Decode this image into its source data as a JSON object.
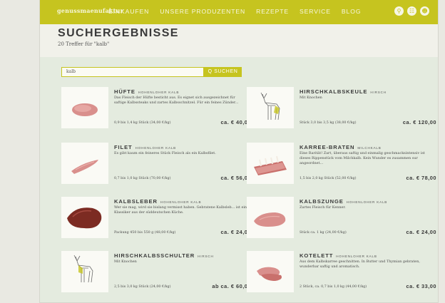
{
  "header": {
    "logo_text": "genussmaenufaktur",
    "nav": [
      "EINKAUFEN",
      "UNSERE PRODUZENTEN",
      "REZEPTE",
      "SERVICE",
      "BLOG"
    ],
    "icons": [
      "search-icon",
      "cart-icon",
      "user-icon"
    ]
  },
  "page": {
    "title": "SUCHERGEBNISSE",
    "subtitle": "20 Treffer für \"kalb\""
  },
  "search": {
    "value": "kalb",
    "button_label": "Q SUCHEN"
  },
  "colors": {
    "accent": "#c6c41f",
    "band": "#e4ebdf",
    "meat": "#d98f8c"
  },
  "products": [
    {
      "name": "HÜFTE",
      "category": "HOHENLOHER KALB",
      "description": "Das Fleisch der Hüfte besticht aus. Es eignet sich ausgezeichnet für saftige Kalbssteaks und zartes Kalbsschnitzel. Für ein feines Zünder...",
      "weight": "0,9 bis 1,4 kg Stück (34,00 €/kg)",
      "price": "ca. € 40,00",
      "icon": "meat-icon"
    },
    {
      "name": "HIRSCHKALBSKEULE",
      "category": "HIRSCH",
      "description": "Mit Knochen",
      "weight": "Stück 3,0 bis 3,5 kg (38,00 €/kg)",
      "price": "ca. € 120,00",
      "icon": "deer-icon"
    },
    {
      "name": "FILET",
      "category": "HOHENLOHER KALB",
      "description": "Es gibt kaum ein feineres Stück Fleisch als ein Kalbsfilet.",
      "weight": "0,7 bis 1,0 kg Stück (70,00 €/kg)",
      "price": "ca. € 56,00",
      "icon": "meat-icon"
    },
    {
      "name": "KARREE-BRATEN",
      "category": "MILCHKALB",
      "description": "Eine Rarität! Zart, überaus saftig und einmalig geschmacksintensiv ist dieses Rippenstück vom Milchkalb. Kein Wunder es zusammen sur angeordnet...",
      "weight": "1,5 bis 2,0 kg Stück (52,00 €/kg)",
      "price": "ca. € 78,00",
      "icon": "rack-icon"
    },
    {
      "name": "KALBSLEBER",
      "category": "HOHENLOHER KALB",
      "description": "Wer sie mag, wird sie bislang vermisst haben. Gebratene Kalbsleb... ist ein Klassiker aus der süddeutschen Küche.",
      "weight": "Packung 450 bis 550 g (48,00 €/kg)",
      "price": "ca. € 24,00",
      "icon": "liver-icon"
    },
    {
      "name": "KALBSZUNGE",
      "category": "HOHENLOHER KALB",
      "description": "Zartes Fleisch für Kenner.",
      "weight": "Stück ca. 1 kg (24,00 €/kg)",
      "price": "ca. € 24,00",
      "icon": "meat-icon"
    },
    {
      "name": "HIRSCHKALBSSCHULTER",
      "category": "HIRSCH",
      "description": "Mit Knochen",
      "weight": "2,5 bis 3,0 kg Stück (24,00 €/kg)",
      "price": "ab ca. € 60,00",
      "icon": "deer-icon"
    },
    {
      "name": "KOTELETT",
      "category": "HOHENLOHER KALB",
      "description": "Aus dem Kalbskarree geschnitten. In Butter und Thymian gebraten, wunderbar saftig und aromatisch.",
      "weight": "2 Stück, ca. 0,7 bis 1,0 kg (44,00 €/kg)",
      "price": "ca. € 33,00",
      "icon": "meat-icon"
    }
  ]
}
